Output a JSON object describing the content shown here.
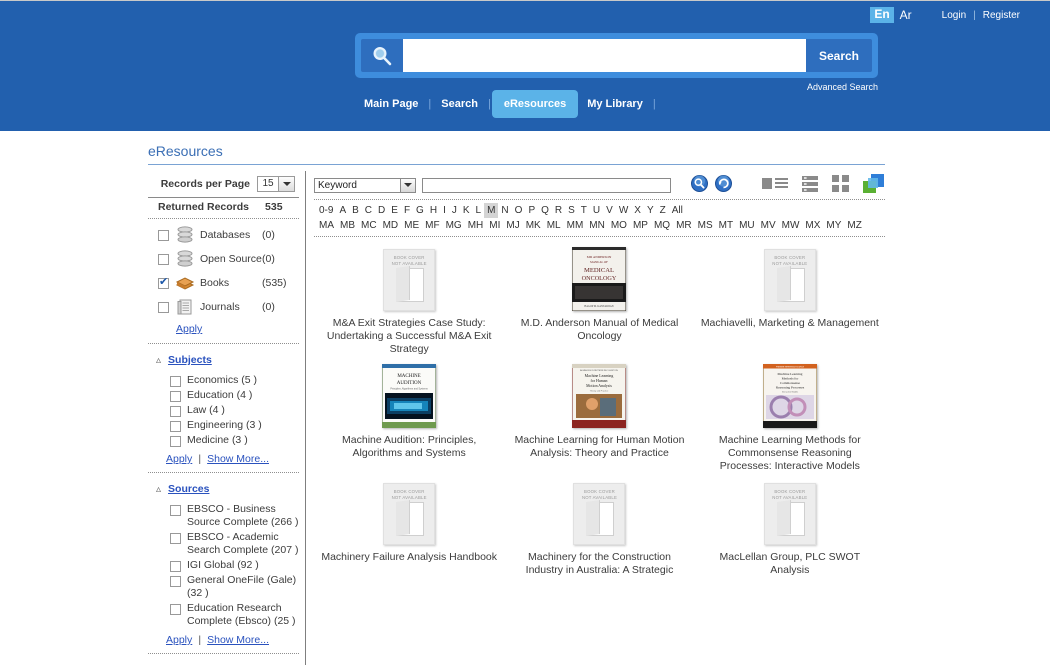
{
  "header": {
    "lang": {
      "en": "En",
      "ar": "Ar"
    },
    "account": {
      "login": "Login",
      "register": "Register"
    },
    "search": {
      "placeholder": "",
      "value": "",
      "button": "Search",
      "advanced": "Advanced Search"
    },
    "nav": [
      {
        "label": "Main Page",
        "active": false
      },
      {
        "label": "Search",
        "active": false
      },
      {
        "label": "eResources",
        "active": true
      },
      {
        "label": "My Library",
        "active": false
      }
    ]
  },
  "page": {
    "title": "eResources"
  },
  "sidebar": {
    "records_per_page": {
      "label": "Records per Page",
      "value": "15"
    },
    "returned": {
      "label": "Returned Records",
      "count": "535"
    },
    "resource_types": [
      {
        "name": "Databases",
        "count": "(0)",
        "checked": false,
        "icon": "database-icon"
      },
      {
        "name": "Open Source",
        "count": "(0)",
        "checked": false,
        "icon": "database-icon"
      },
      {
        "name": "Books",
        "count": "(535)",
        "checked": true,
        "icon": "books-icon"
      },
      {
        "name": "Journals",
        "count": "(0)",
        "checked": false,
        "icon": "journal-icon"
      }
    ],
    "apply_label": "Apply",
    "show_more_label": "Show More...",
    "subjects": {
      "title": "Subjects",
      "items": [
        {
          "label": "Economics (5 )",
          "checked": false
        },
        {
          "label": "Education (4 )",
          "checked": false
        },
        {
          "label": "Law (4 )",
          "checked": false
        },
        {
          "label": "Engineering (3 )",
          "checked": false
        },
        {
          "label": "Medicine (3 )",
          "checked": false
        }
      ]
    },
    "sources": {
      "title": "Sources",
      "items": [
        {
          "label": "EBSCO - Business Source Complete (266 )",
          "checked": false
        },
        {
          "label": "EBSCO - Academic Search Complete (207 )",
          "checked": false
        },
        {
          "label": "IGI Global (92 )",
          "checked": false
        },
        {
          "label": "General OneFile (Gale) (32 )",
          "checked": false
        },
        {
          "label": "Education Research Complete (Ebsco) (25 )",
          "checked": false
        }
      ]
    }
  },
  "toolbar": {
    "field_select": {
      "value": "Keyword"
    },
    "filter_input": {
      "value": "",
      "placeholder": ""
    },
    "icons": [
      {
        "name": "search-circle-icon"
      },
      {
        "name": "refresh-circle-icon"
      },
      {
        "name": "list-view-icon"
      },
      {
        "name": "detail-view-icon"
      },
      {
        "name": "grid-view-icon"
      },
      {
        "name": "gallery-view-icon"
      }
    ]
  },
  "alphabet": {
    "row1": [
      "0-9",
      "A",
      "B",
      "C",
      "D",
      "E",
      "F",
      "G",
      "H",
      "I",
      "J",
      "K",
      "L",
      "M",
      "N",
      "O",
      "P",
      "Q",
      "R",
      "S",
      "T",
      "U",
      "V",
      "W",
      "X",
      "Y",
      "Z",
      "All"
    ],
    "row2": [
      "MA",
      "MB",
      "MC",
      "MD",
      "ME",
      "MF",
      "MG",
      "MH",
      "MI",
      "MJ",
      "MK",
      "ML",
      "MM",
      "MN",
      "MO",
      "MP",
      "MQ",
      "MR",
      "MS",
      "MT",
      "MU",
      "MV",
      "MW",
      "MX",
      "MY",
      "MZ"
    ],
    "selected": "M"
  },
  "results": {
    "placeholder_text_line1": "BOOK COVER",
    "placeholder_text_line2": "NOT AVAILABLE",
    "items": [
      {
        "title": "M&A Exit Strategies Case Study: Undertaking a Successful M&A Exit Strategy",
        "cover": "placeholder"
      },
      {
        "title": "M.D. Anderson Manual of Medical Oncology",
        "cover": "md-anderson-cover"
      },
      {
        "title": "Machiavelli, Marketing & Management",
        "cover": "placeholder"
      },
      {
        "title": "Machine Audition: Principles, Algorithms and Systems",
        "cover": "machine-audition-cover"
      },
      {
        "title": "Machine Learning for Human Motion Analysis: Theory and Practice",
        "cover": "human-motion-cover"
      },
      {
        "title": "Machine Learning Methods for Commonsense Reasoning Processes: Interactive Models",
        "cover": "commonsense-cover"
      },
      {
        "title": "Machinery Failure Analysis Handbook",
        "cover": "placeholder"
      },
      {
        "title": "Machinery for the Construction Industry in Australia: A Strategic",
        "cover": "placeholder"
      },
      {
        "title": "MacLellan Group, PLC SWOT Analysis",
        "cover": "placeholder"
      }
    ]
  },
  "colors": {
    "header_blue": "#2260AE",
    "accent_blue": "#5BB3E8",
    "link_blue": "#2a52be",
    "title_blue": "#3b6fb5"
  }
}
